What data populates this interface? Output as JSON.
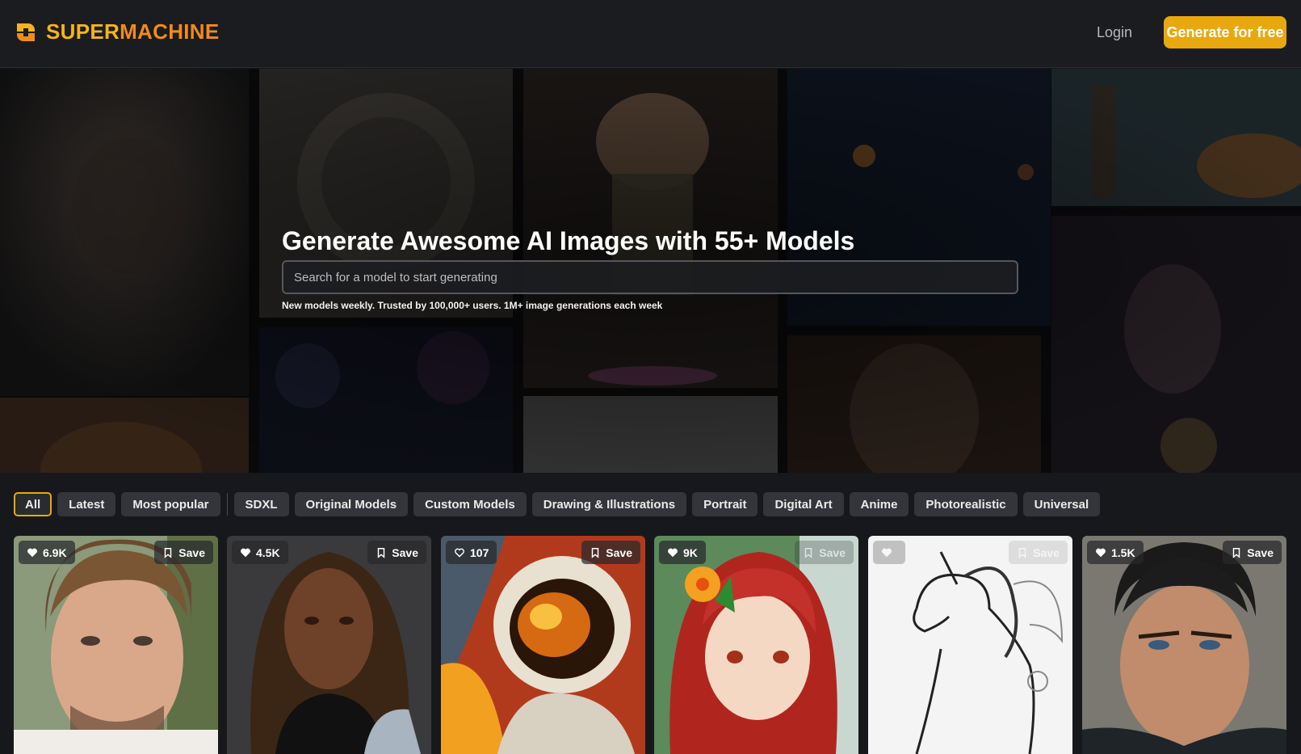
{
  "brand": {
    "name_part1": "SUPER",
    "name_part2": "MACHINE",
    "color_primary": "#f4b41a",
    "color_secondary": "#f08b1c"
  },
  "header": {
    "login_label": "Login",
    "cta_label": "Generate for free"
  },
  "hero": {
    "title": "Generate Awesome AI Images with 55+ Models",
    "search_placeholder": "Search for a model to start generating",
    "subtitle": "New models weekly. Trusted by 100,000+ users. 1M+ image generations each week"
  },
  "filters": {
    "primary": [
      "All",
      "Latest",
      "Most popular"
    ],
    "categories": [
      "SDXL",
      "Original Models",
      "Custom Models",
      "Drawing & Illustrations",
      "Portrait",
      "Digital Art",
      "Anime",
      "Photorealistic",
      "Universal"
    ],
    "active": "All"
  },
  "cards": [
    {
      "likes": "6.9K",
      "liked": true,
      "save_label": "Save",
      "subject": "man-portrait"
    },
    {
      "likes": "4.5K",
      "liked": true,
      "save_label": "Save",
      "subject": "woman-portrait"
    },
    {
      "likes": "107",
      "liked": false,
      "save_label": "Save",
      "subject": "astronaut-painting"
    },
    {
      "likes": "9K",
      "liked": true,
      "save_label": "Save",
      "subject": "anime-girl"
    },
    {
      "likes": "",
      "liked": true,
      "save_label": "Save",
      "subject": "unicorn-line-art"
    },
    {
      "likes": "1.5K",
      "liked": true,
      "save_label": "Save",
      "subject": "man-portrait-dark"
    }
  ],
  "icons": {
    "heart": "heart-icon",
    "bookmark": "bookmark-icon",
    "logo": "logo-icon"
  }
}
